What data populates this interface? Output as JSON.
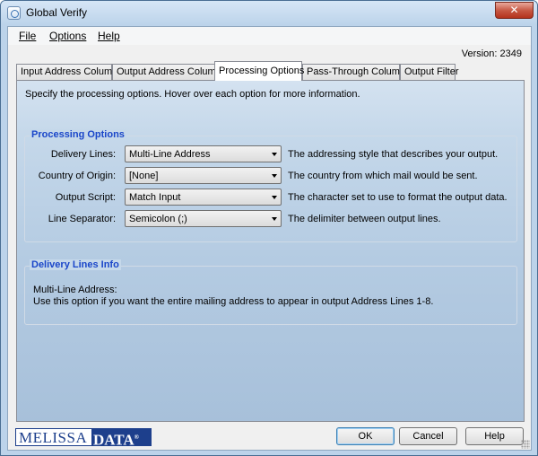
{
  "window": {
    "title": "Global Verify",
    "close_glyph": "✕"
  },
  "menu": {
    "file": "File",
    "options": "Options",
    "help": "Help"
  },
  "version": "Version: 2349",
  "tabs": [
    {
      "label": "Input Address Columns"
    },
    {
      "label": "Output Address Columns"
    },
    {
      "label": "Processing Options",
      "active": true
    },
    {
      "label": "Pass-Through Columns"
    },
    {
      "label": "Output Filter"
    }
  ],
  "intro": "Specify the processing options. Hover over each option for more information.",
  "processing": {
    "legend": "Processing Options",
    "rows": [
      {
        "label": "Delivery Lines:",
        "value": "Multi-Line Address",
        "description": "The addressing style that describes your output."
      },
      {
        "label": "Country of Origin:",
        "value": "[None]",
        "description": "The country from which mail would be sent."
      },
      {
        "label": "Output Script:",
        "value": "Match Input",
        "description": "The character set to use to format the output data."
      },
      {
        "label": "Line Separator:",
        "value": "Semicolon (;)",
        "description": "The delimiter between output lines."
      }
    ]
  },
  "info": {
    "legend": "Delivery Lines Info",
    "line1": "Multi-Line Address:",
    "line2": "Use this option if you want the entire mailing address to appear in output Address Lines 1-8."
  },
  "logo": {
    "melissa": "MELISSA",
    "data": "DATA",
    "mark": "®"
  },
  "buttons": {
    "ok": "OK",
    "cancel": "Cancel",
    "help": "Help"
  },
  "colors": {
    "legend": "#1a46c9",
    "logo": "#1d3f8c",
    "titlebar": "#bcd3ea"
  }
}
